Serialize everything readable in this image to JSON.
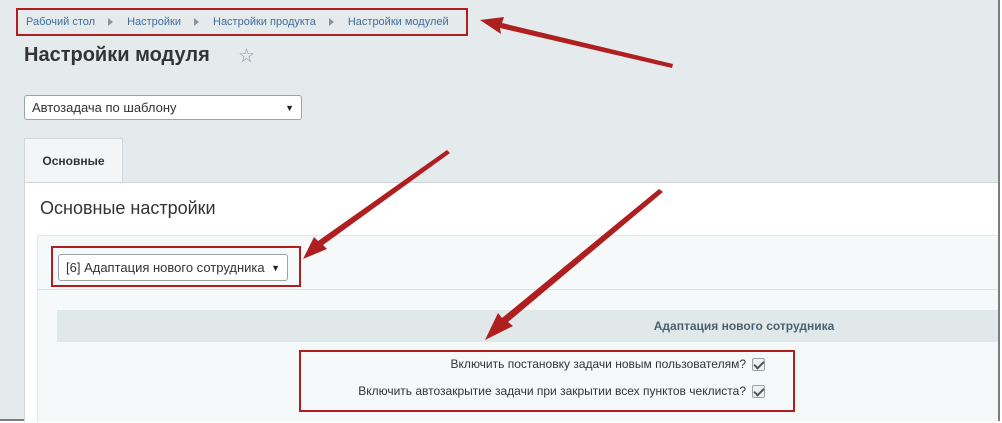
{
  "breadcrumb": {
    "items": [
      "Рабочий стол",
      "Настройки",
      "Настройки продукта",
      "Настройки модулей"
    ]
  },
  "page": {
    "title": "Настройки модуля",
    "star_icon": "star-icon"
  },
  "module_select": {
    "value": "Автозадача по шаблону"
  },
  "tabs": [
    {
      "label": "Основные"
    }
  ],
  "section": {
    "title": "Основные настройки"
  },
  "template_select": {
    "value": "[6] Адаптация нового сотрудника"
  },
  "settings_group": {
    "heading": "Адаптация нового сотрудника",
    "options": [
      {
        "label": "Включить постановку задачи новым пользователям?",
        "checked": true
      },
      {
        "label": "Включить автозакрытие задачи при закрытии всех пунктов чеклиста?",
        "checked": true
      }
    ]
  },
  "colors": {
    "annotation": "#b01f1f",
    "link": "#3f6e99",
    "background": "#e5eaed"
  }
}
